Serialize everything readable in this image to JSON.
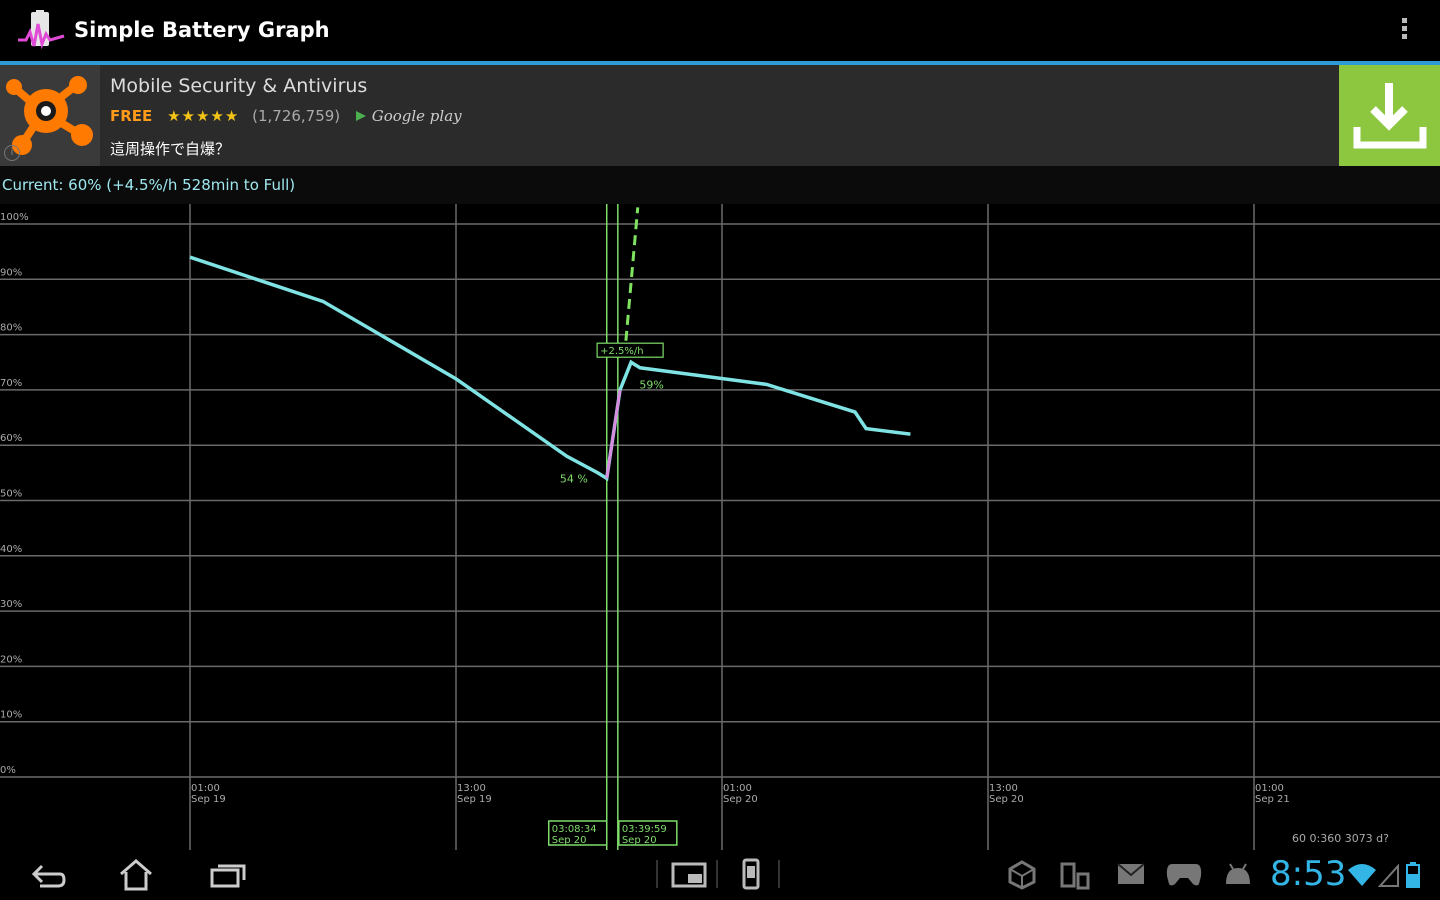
{
  "app": {
    "title": "Simple Battery Graph",
    "icon": "battery-graph-icon"
  },
  "ad": {
    "title": "Mobile Security & Antivirus",
    "price": "FREE",
    "stars": "★★★★★",
    "reviews": "(1,726,759)",
    "store": "Google play",
    "subtitle": "這周操作で自爆？",
    "info_icon": "i",
    "brand_color": "#ff8a00",
    "button_color": "#8dc63f"
  },
  "status": {
    "text": "Current: 60%  (+4.5%/h  528min to Full)"
  },
  "chart_data": {
    "type": "line",
    "y_axis": {
      "range": [
        0,
        100
      ],
      "ticks": [
        "0%",
        "10%",
        "20%",
        "30%",
        "40%",
        "50%",
        "60%",
        "70%",
        "80%",
        "90%",
        "100%"
      ]
    },
    "x_axis": {
      "ticks": [
        {
          "time": "01:00",
          "date": "Sep 19"
        },
        {
          "time": "13:00",
          "date": "Sep 19"
        },
        {
          "time": "01:00",
          "date": "Sep 20"
        },
        {
          "time": "13:00",
          "date": "Sep 20"
        },
        {
          "time": "01:00",
          "date": "Sep 21"
        }
      ]
    },
    "series": [
      {
        "color": "#7fe3e3",
        "points": [
          [
            0,
            94
          ],
          [
            6,
            86
          ],
          [
            12,
            72
          ],
          [
            17,
            58
          ],
          [
            18.4,
            55
          ],
          [
            18.8,
            54
          ],
          [
            19.4,
            70
          ],
          [
            19.9,
            75
          ],
          [
            20.3,
            74
          ],
          [
            26,
            71
          ],
          [
            30,
            66
          ],
          [
            30.5,
            63
          ],
          [
            32.5,
            62
          ]
        ]
      }
    ],
    "charge_segment": {
      "color": "#d98be0",
      "points": [
        [
          18.8,
          54
        ],
        [
          19.4,
          70
        ]
      ]
    },
    "projection": {
      "color": "#7fe35f",
      "points": [
        [
          19.6,
          76
        ],
        [
          20.2,
          103
        ]
      ]
    },
    "annotations": [
      {
        "label": "54 %",
        "x": 18.4,
        "y": 54
      },
      {
        "label": "59%",
        "x": 20.0,
        "y": 71
      },
      {
        "label": "+2.5%/h",
        "x": 19.9,
        "y": 77
      }
    ],
    "markers": [
      {
        "time": "03:08:34",
        "date": "Sep 20",
        "x": 18.8
      },
      {
        "time": "03:39:59",
        "date": "Sep 20",
        "x": 19.3
      }
    ]
  },
  "legend_mini": "60  0:360  3073 d?",
  "navbar": {
    "clock": "8:53",
    "icons": [
      "back-icon",
      "home-icon",
      "recent-apps-icon",
      "screenshot-icon",
      "phone-icon",
      "cube-icon",
      "usb-icon",
      "mail-icon",
      "gamepad-icon",
      "android-icon",
      "wifi-icon",
      "signal-icon",
      "battery-icon"
    ]
  }
}
